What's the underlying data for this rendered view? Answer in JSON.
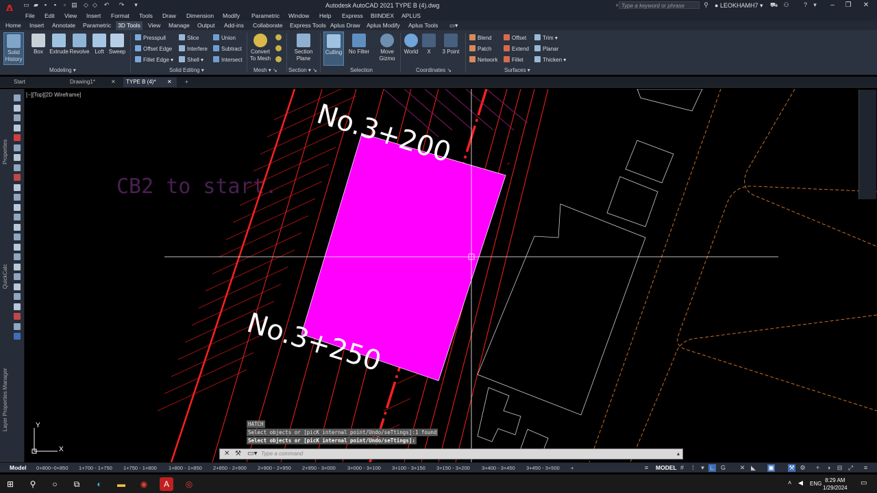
{
  "app": {
    "logo_letter": "A",
    "title": "Autodesk AutoCAD 2021    TYPE B (4).dwg",
    "search_placeholder": "Type a keyword or phrase",
    "user": "LEOKHAMH7"
  },
  "menus": [
    "File",
    "Edit",
    "View",
    "Insert",
    "Format",
    "Tools",
    "Draw",
    "Dimension",
    "Modify",
    "Parametric",
    "Window",
    "Help",
    "Express",
    "BIINDEX",
    "APLUS"
  ],
  "ribbon_tabs": [
    "Home",
    "Insert",
    "Annotate",
    "Parametric",
    "3D Tools",
    "View",
    "Manage",
    "Output",
    "Add-ins",
    "Collaborate",
    "Express Tools",
    "Aplus Draw",
    "Aplus Modify",
    "Aplus Tools"
  ],
  "ribbon_active_tab": "3D Tools",
  "ribbon": {
    "solid_history": [
      "Solid",
      "History"
    ],
    "modeling": [
      "Box",
      "Extrude",
      "Revolve",
      "Loft",
      "Sweep"
    ],
    "presspull": [
      "Presspull",
      "Offset Edge",
      "Fillet Edge"
    ],
    "solid_edit_mid": [
      "Slice",
      "Interfere",
      "Shell"
    ],
    "solid_edit_right": [
      "Union",
      "Subtract",
      "Intersect"
    ],
    "convert_mesh": [
      "Convert",
      "To Mesh"
    ],
    "section_plane": [
      "Section",
      "Plane"
    ],
    "selection": [
      "Culling",
      "No Filter",
      "Move",
      "Gizmo"
    ],
    "coordinates": [
      "World",
      "X",
      "3 Point"
    ],
    "surfaces_left": [
      "Blend",
      "Patch",
      "Network"
    ],
    "surfaces_mid": [
      "Offset",
      "Extend",
      "Fillet"
    ],
    "surfaces_right": [
      "Trim",
      "Planar",
      "Thicken"
    ],
    "groups": [
      "Modeling",
      "Solid Editing",
      "Mesh",
      "Section",
      "Selection",
      "Coordinates",
      "Surfaces"
    ]
  },
  "doc_tabs": [
    "Start",
    "Drawing1*",
    "TYPE B (4)*"
  ],
  "view_label": "[−][Top][2D Wireframe]",
  "palette_labels": [
    "Properties",
    "QuickCalc",
    "Layer Properties Manager"
  ],
  "drawing": {
    "label_top": "No.3+200",
    "label_bottom": "No.3+250",
    "faded_text": "CB2 to start.",
    "hatch_color": "#ff00ff",
    "road_color": "#ff2020",
    "ucs_y": "Y",
    "ucs_x": "X"
  },
  "command_history": [
    "HATCH",
    "Select objects or [picK internal point/Undo/seTtings]:1 found",
    "Select objects or [picK internal point/Undo/seTtings]:"
  ],
  "command_placeholder": "Type a command",
  "layout_tabs": [
    "Model",
    "0+800~0+850",
    "1+700 - 1+750",
    "1+750 - 1+800",
    "1+800 - 1+850",
    "2+850 - 2+900",
    "2+900 - 2+950",
    "2+950 - 3+000",
    "3+000 - 3+100",
    "3+100 - 3+150",
    "3+150 - 3+200",
    "3+400 - 3+450",
    "3+450 - 3+500"
  ],
  "status_model": "MODEL",
  "taskbar": {
    "lang": "ENG",
    "time": "8:29 AM",
    "date": "1/29/2024"
  }
}
